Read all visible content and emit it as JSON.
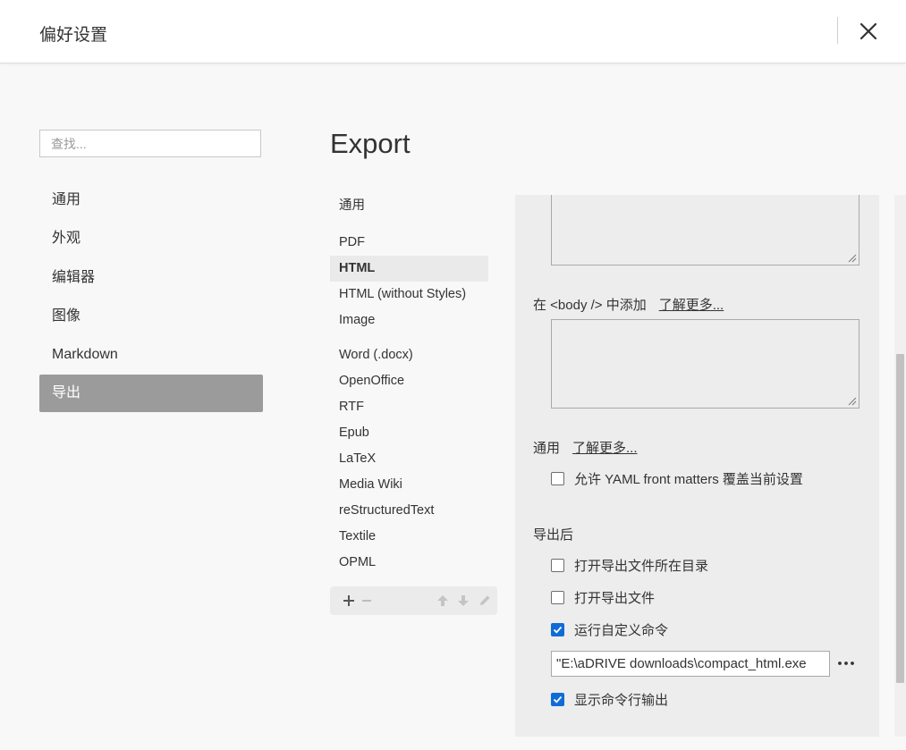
{
  "window": {
    "title": "偏好设置"
  },
  "search": {
    "placeholder": "查找..."
  },
  "nav": {
    "items": [
      {
        "label": "通用"
      },
      {
        "label": "外观"
      },
      {
        "label": "编辑器"
      },
      {
        "label": "图像"
      },
      {
        "label": "Markdown"
      },
      {
        "label": "导出",
        "active": true
      }
    ]
  },
  "export": {
    "title": "Export",
    "formats": [
      {
        "label": "通用"
      },
      {
        "label": "PDF"
      },
      {
        "label": "HTML",
        "active": true
      },
      {
        "label": "HTML (without Styles)"
      },
      {
        "label": "Image"
      },
      {
        "label": "Word (.docx)"
      },
      {
        "label": "OpenOffice"
      },
      {
        "label": "RTF"
      },
      {
        "label": "Epub"
      },
      {
        "label": "LaTeX"
      },
      {
        "label": "Media Wiki"
      },
      {
        "label": "reStructuredText"
      },
      {
        "label": "Textile"
      },
      {
        "label": "OPML"
      }
    ],
    "toolbar": {
      "add": "+",
      "remove": "−"
    }
  },
  "settings": {
    "body_label": "在 <body /> 中添加",
    "body_learn_more": "了解更多...",
    "general_label": "通用",
    "general_learn_more": "了解更多...",
    "yaml_override": {
      "label": "允许 YAML front matters 覆盖当前设置",
      "checked": false
    },
    "after_export_label": "导出后",
    "open_folder": {
      "label": "打开导出文件所在目录",
      "checked": false
    },
    "open_file": {
      "label": "打开导出文件",
      "checked": false
    },
    "run_command": {
      "label": "运行自定义命令",
      "checked": true
    },
    "command_value": "\"E:\\aDRIVE downloads\\compact_html.exe",
    "show_output": {
      "label": "显示命令行输出",
      "checked": true
    }
  },
  "colors": {
    "accent": "#0f6cd6",
    "nav_active_bg": "#9b9b9b",
    "panel_bg": "#ededed"
  }
}
